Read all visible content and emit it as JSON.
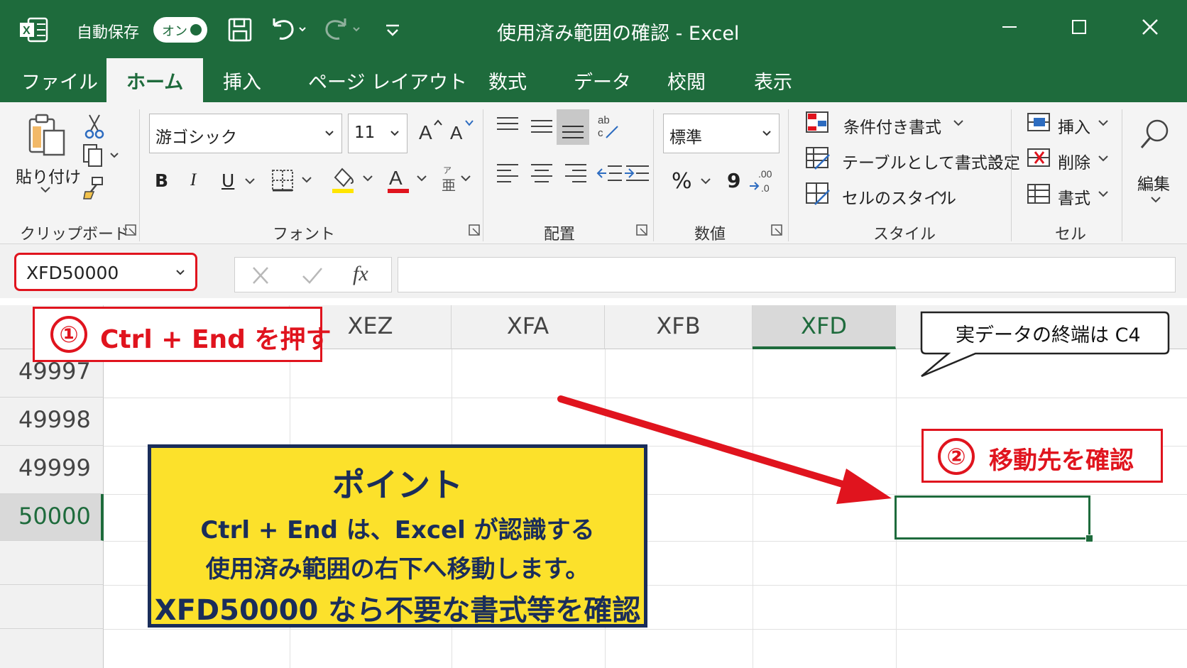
{
  "titlebar": {
    "autosave_label": "自動保存",
    "autosave_state": "オン",
    "title": "使用済み範囲の確認 - Excel"
  },
  "tabs": [
    "ファイル",
    "ホーム",
    "挿入",
    "ページ レイアウト",
    "数式",
    "データ",
    "校閲",
    "表示"
  ],
  "active_tab": "ホーム",
  "ribbon": {
    "clipboard": {
      "paste_label": "貼り付け",
      "group_label": "クリップボード"
    },
    "font": {
      "font_name": "游ゴシック",
      "font_size": "11",
      "bold": "B",
      "italic": "I",
      "underline": "U",
      "group_label": "フォント"
    },
    "alignment": {
      "group_label": "配置"
    },
    "number": {
      "format": "標準",
      "percent": "%",
      "comma": "9",
      "group_label": "数値"
    },
    "styles": {
      "conditional_formatting": "条件付き書式",
      "format_as_table": "テーブルとして書式設定",
      "cell_styles": "セルのスタイル",
      "group_label": "スタイル"
    },
    "cells": {
      "insert": "挿入",
      "delete": "削除",
      "format": "書式",
      "group_label": "セル"
    },
    "editing": {
      "label": "編集"
    }
  },
  "formula_bar": {
    "name_box": "XFD50000",
    "fx": "fx",
    "formula": ""
  },
  "grid": {
    "columns": [
      "XEZ",
      "XFA",
      "XFB",
      "XFD"
    ],
    "selected_column": "XFD",
    "rows": [
      "49997",
      "49998",
      "49999",
      "50000"
    ],
    "selected_row": "50000"
  },
  "annotations": {
    "step1_number": "①",
    "step1_text": "Ctrl + End を押す",
    "step2_number": "②",
    "step2_text": "移動先を確認",
    "bubble_text": "実データの終端は C4",
    "point_title": "ポイント",
    "point_lines": [
      "Ctrl + End は、Excel が認識する",
      "使用済み範囲の右下へ移動します。",
      "XFD50000 なら不要な書式等を確認"
    ]
  },
  "colors": {
    "excel_green": "#1e6b3c",
    "annotation_red": "#e0141e",
    "point_yellow": "#fce12b",
    "point_navy": "#1a2d5a"
  },
  "icons": [
    "excel-logo-icon",
    "save-icon",
    "undo-icon",
    "redo-icon",
    "customize-qat-icon",
    "minimize-icon",
    "maximize-icon",
    "close-icon",
    "paste-icon",
    "cut-icon",
    "copy-icon",
    "format-painter-icon",
    "search-icon"
  ]
}
